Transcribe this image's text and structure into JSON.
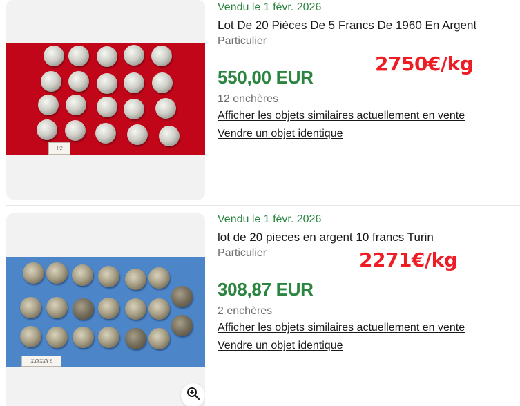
{
  "listings": [
    {
      "sold_date": "Vendu le 1 févr. 2026",
      "title": "Lot De 20 Pièces De 5 Francs De 1960 En Argent",
      "seller_type": "Particulier",
      "price": "550,00 EUR",
      "bids": "12 enchères",
      "similar_link": "Afficher les objets similaires actuellement en vente",
      "sell_link": "Vendre un objet identique",
      "price_per_kg": "2750€/kg",
      "photo_tag": "1/2"
    },
    {
      "sold_date": "Vendu le 1 févr. 2026",
      "title": "lot de 20 pieces en argent 10 francs Turin",
      "seller_type": "Particulier",
      "price": "308,87 EUR",
      "bids": "2 enchères",
      "similar_link": "Afficher les objets similaires actuellement en vente",
      "sell_link": "Vendre un objet identique",
      "price_per_kg": "2271€/kg",
      "photo_tag": "XXXXXX €",
      "zoom_icon": "zoom-in-icon"
    }
  ],
  "colors": {
    "sold_green": "#2b8540",
    "price_green": "#2b8540",
    "annotation_red": "#ee1c24",
    "photo_bg_1": "#c1061a",
    "photo_bg_2": "#4d86c8"
  }
}
